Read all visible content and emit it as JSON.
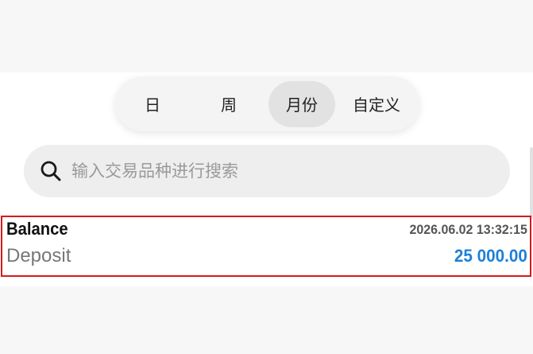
{
  "period_tabs": [
    {
      "label": "日",
      "selected": false
    },
    {
      "label": "周",
      "selected": false
    },
    {
      "label": "月份",
      "selected": true
    },
    {
      "label": "自定义",
      "selected": false
    }
  ],
  "search": {
    "placeholder": "输入交易品种进行搜索",
    "icon": "search-icon"
  },
  "transactions": [
    {
      "type": "Balance",
      "datetime": "2026.06.02 13:32:15",
      "description": "Deposit",
      "amount": "25 000.00"
    }
  ],
  "colors": {
    "amount": "#1e7fd6",
    "highlight_border": "#d61a1a",
    "selected_tab_bg": "#e2e2e2"
  }
}
